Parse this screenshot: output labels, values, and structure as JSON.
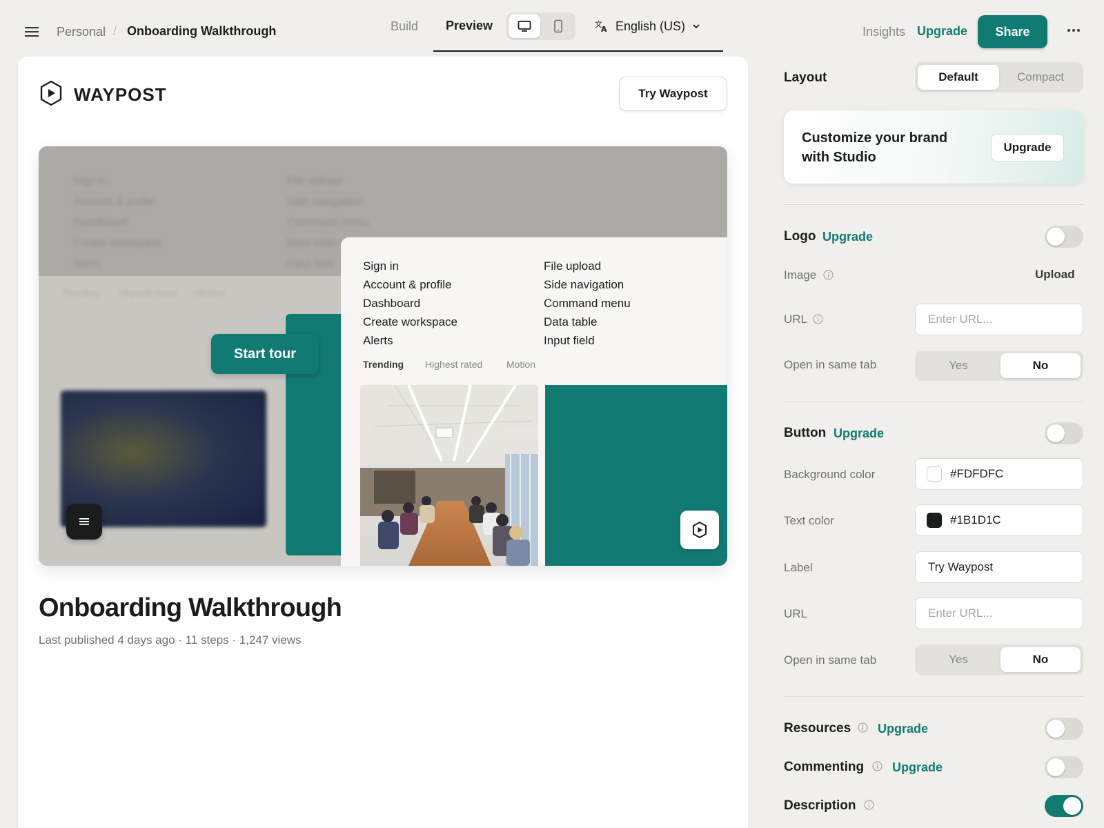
{
  "topbar": {
    "breadcrumb": {
      "parent": "Personal",
      "separator": "/",
      "current": "Onboarding Walkthrough"
    },
    "tabs": {
      "build": "Build",
      "preview": "Preview"
    },
    "language": "English (US)",
    "insights": "Insights",
    "upgrade": "Upgrade",
    "share": "Share",
    "icons": {
      "menu": "hamburger-menu-icon",
      "desktop": "desktop-icon",
      "mobile": "mobile-icon",
      "language": "translate-icon",
      "dropdown": "chevron-down-icon",
      "more": "more-horizontal-icon"
    }
  },
  "preview": {
    "brand_name": "WAYPOST",
    "try_button": "Try Waypost",
    "start_tour": "Start tour",
    "menu_col1": [
      "Sign in",
      "Account & profile",
      "Dashboard",
      "Create workspace",
      "Alerts"
    ],
    "menu_col2": [
      "File upload",
      "Side navigation",
      "Command menu",
      "Data table",
      "Input field"
    ],
    "filter_tabs": [
      "Trending",
      "Highest rated",
      "Motion"
    ],
    "title": "Onboarding Walkthrough",
    "meta": "Last published 4 days ago · 11 steps · 1,247 views"
  },
  "sidebar": {
    "layout": {
      "label": "Layout",
      "options": [
        "Default",
        "Compact"
      ],
      "selected": "Default"
    },
    "promo": {
      "text": "Customize your brand with Studio",
      "button": "Upgrade"
    },
    "logo": {
      "title": "Logo",
      "upgrade": "Upgrade",
      "enabled": false,
      "image_label": "Image",
      "upload": "Upload",
      "url_label": "URL",
      "url_placeholder": "Enter URL...",
      "same_tab_label": "Open in same tab",
      "yes": "Yes",
      "no": "No",
      "same_tab": "No"
    },
    "button": {
      "title": "Button",
      "upgrade": "Upgrade",
      "enabled": false,
      "bg_label": "Background color",
      "bg_value": "#FDFDFC",
      "text_label": "Text color",
      "text_value": "#1B1D1C",
      "label_label": "Label",
      "label_value": "Try Waypost",
      "url_label": "URL",
      "url_placeholder": "Enter URL...",
      "same_tab_label": "Open in same tab",
      "yes": "Yes",
      "no": "No",
      "same_tab": "No"
    },
    "resources": {
      "title": "Resources",
      "upgrade": "Upgrade",
      "enabled": false
    },
    "commenting": {
      "title": "Commenting",
      "upgrade": "Upgrade",
      "enabled": false
    },
    "description": {
      "title": "Description",
      "enabled": true
    }
  },
  "colors": {
    "accent": "#117A73",
    "text": "#1B1D1C",
    "muted": "#6F716F",
    "background": "#F1EFEC"
  }
}
